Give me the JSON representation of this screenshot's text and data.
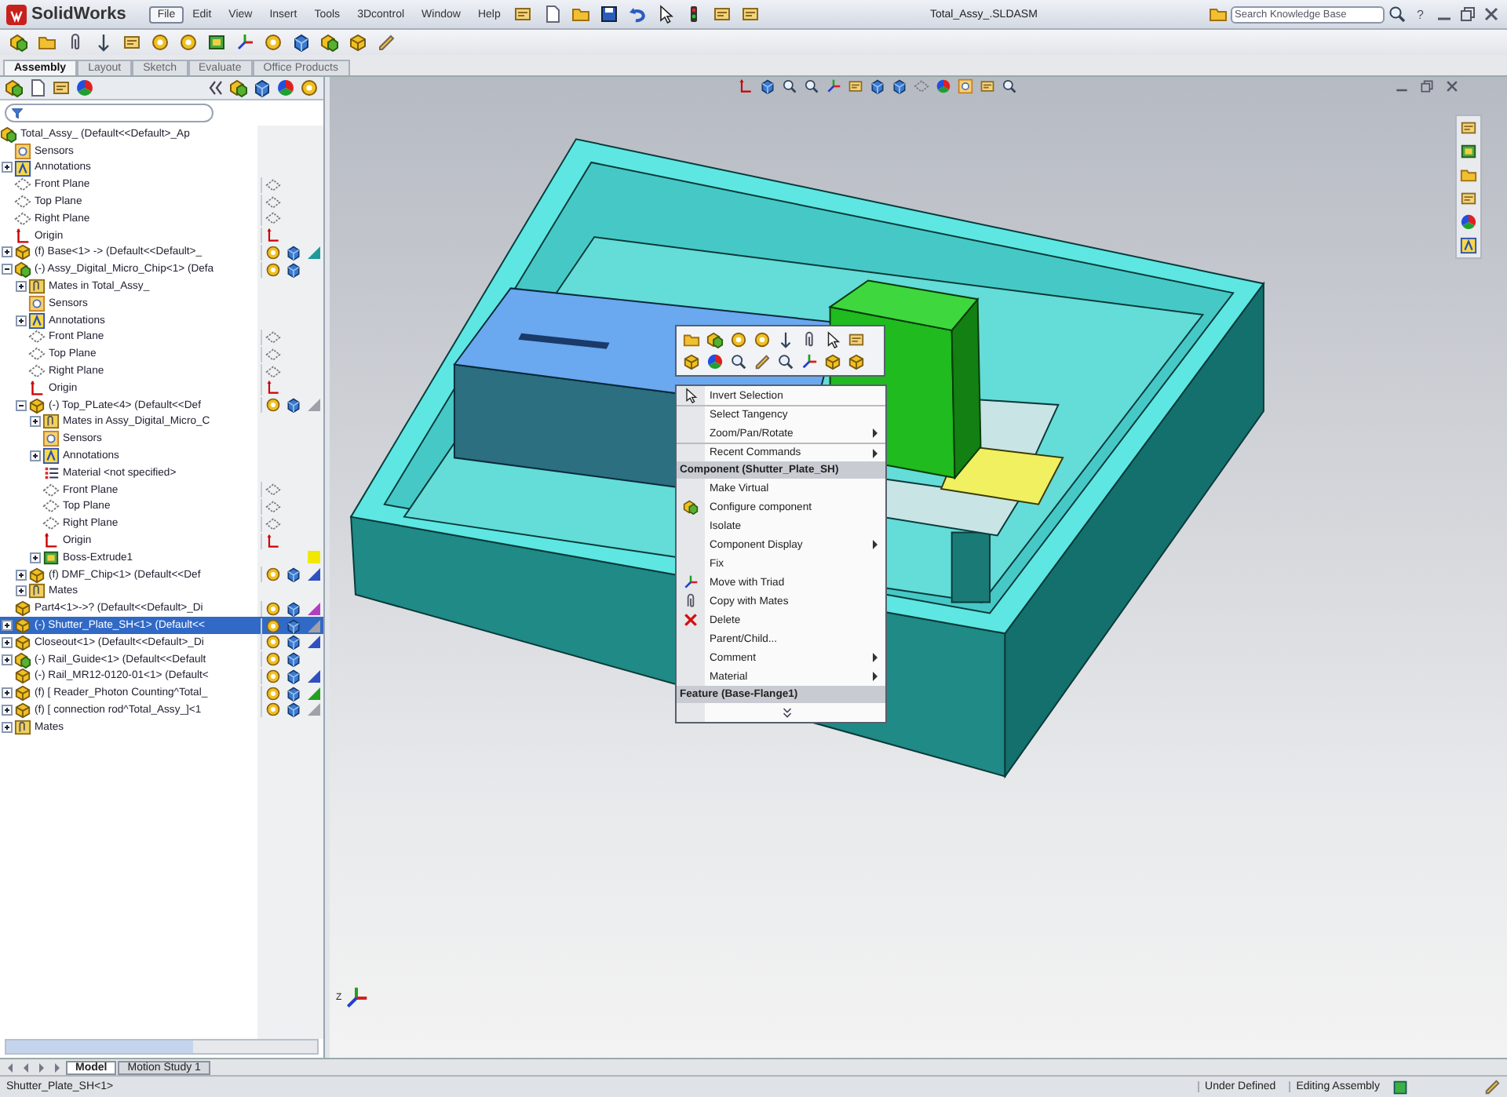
{
  "app": {
    "logo": "SolidWorks",
    "menu": [
      {
        "label": "File",
        "selected": true
      },
      {
        "label": "Edit",
        "selected": false
      },
      {
        "label": "View",
        "selected": false
      },
      {
        "label": "Insert",
        "selected": false
      },
      {
        "label": "Tools",
        "selected": false
      },
      {
        "label": "3Dcontrol",
        "selected": false
      },
      {
        "label": "Window",
        "selected": false
      },
      {
        "label": "Help",
        "selected": false
      }
    ],
    "title": "Total_Assy_.SLDASM",
    "search": {
      "placeholder": "Search Knowledge Base"
    },
    "help": "?"
  },
  "command_tabs": [
    {
      "label": "Assembly",
      "selected": true
    },
    {
      "label": "Layout",
      "selected": false
    },
    {
      "label": "Sketch",
      "selected": false
    },
    {
      "label": "Evaluate",
      "selected": false
    },
    {
      "label": "Office Products",
      "selected": false
    }
  ],
  "feature_tree": {
    "items": [
      {
        "label": "Total_Assy_ (Default<<Default>_Ap",
        "kind": "assembly",
        "selected": false,
        "children": [
          {
            "label": "Sensors",
            "kind": "sensors",
            "selected": false
          },
          {
            "label": "Annotations",
            "kind": "annotations",
            "expanded": false,
            "selected": false
          },
          {
            "label": "Front Plane",
            "kind": "plane",
            "selected": false
          },
          {
            "label": "Top Plane",
            "kind": "plane",
            "selected": false
          },
          {
            "label": "Right Plane",
            "kind": "plane",
            "selected": false
          },
          {
            "label": "Origin",
            "kind": "origin",
            "selected": false
          },
          {
            "label": "(f) Base<1> -> (Default<<Default>_",
            "kind": "part",
            "expanded": false,
            "selected": false,
            "color": "#1e9a9a"
          },
          {
            "label": "(-) Assy_Digital_Micro_Chip<1> (Defa",
            "kind": "assembly",
            "expanded": true,
            "selected": false,
            "children": [
              {
                "label": "Mates in Total_Assy_",
                "kind": "mates",
                "expanded": false,
                "selected": false
              },
              {
                "label": "Sensors",
                "kind": "sensors",
                "selected": false
              },
              {
                "label": "Annotations",
                "kind": "annotations",
                "expanded": false,
                "selected": false
              },
              {
                "label": "Front Plane",
                "kind": "plane",
                "selected": false
              },
              {
                "label": "Top Plane",
                "kind": "plane",
                "selected": false
              },
              {
                "label": "Right Plane",
                "kind": "plane",
                "selected": false
              },
              {
                "label": "Origin",
                "kind": "origin",
                "selected": false
              },
              {
                "label": "(-) Top_PLate<4> (Default<<Def",
                "kind": "part",
                "expanded": true,
                "selected": false,
                "color": "#a0a0a8",
                "children": [
                  {
                    "label": "Mates in Assy_Digital_Micro_C",
                    "kind": "mates",
                    "expanded": false,
                    "selected": false
                  },
                  {
                    "label": "Sensors",
                    "kind": "sensors",
                    "selected": false
                  },
                  {
                    "label": "Annotations",
                    "kind": "annotations",
                    "expanded": false,
                    "selected": false
                  },
                  {
                    "label": "Material <not specified>",
                    "kind": "material",
                    "selected": false
                  },
                  {
                    "label": "Front Plane",
                    "kind": "plane",
                    "selected": false
                  },
                  {
                    "label": "Top Plane",
                    "kind": "plane",
                    "selected": false
                  },
                  {
                    "label": "Right Plane",
                    "kind": "plane",
                    "selected": false
                  },
                  {
                    "label": "Origin",
                    "kind": "origin",
                    "selected": false
                  },
                  {
                    "label": "Boss-Extrude1",
                    "kind": "feature",
                    "expanded": false,
                    "selected": false,
                    "color": "#f0e800"
                  }
                ]
              },
              {
                "label": "(f) DMF_Chip<1> (Default<<Def",
                "kind": "part",
                "expanded": false,
                "selected": false,
                "color": "#3050c0"
              },
              {
                "label": "Mates",
                "kind": "mates",
                "expanded": false,
                "selected": false
              }
            ]
          },
          {
            "label": "Part4<1>->? (Default<<Default>_Di",
            "kind": "part",
            "selected": false,
            "color": "#b040c0"
          },
          {
            "label": "(-) Shutter_Plate_SH<1> (Default<<",
            "kind": "part",
            "expanded": false,
            "selected": true,
            "color": "#a0a0a8"
          },
          {
            "label": "Closeout<1> (Default<<Default>_Di",
            "kind": "part",
            "expanded": false,
            "selected": false,
            "color": "#3050c0"
          },
          {
            "label": "(-) Rail_Guide<1> (Default<<Default",
            "kind": "assembly",
            "expanded": false,
            "selected": false
          },
          {
            "label": "(-) Rail_MR12-0120-01<1> (Default<",
            "kind": "part",
            "selected": false,
            "color": "#3050c0"
          },
          {
            "label": "(f) [ Reader_Photon Counting^Total_",
            "kind": "part",
            "expanded": false,
            "selected": false,
            "color": "#20a020"
          },
          {
            "label": "(f) [ connection rod^Total_Assy_]<1",
            "kind": "part",
            "expanded": false,
            "selected": false,
            "color": "#a0a0a8"
          },
          {
            "label": "Mates",
            "kind": "mates",
            "expanded": false,
            "selected": false
          }
        ]
      }
    ]
  },
  "bottom_tabs": [
    {
      "label": "Model",
      "selected": true
    },
    {
      "label": "Motion Study 1",
      "selected": false
    }
  ],
  "context_menu": {
    "items": [
      {
        "label": "Invert Selection",
        "kind": "item",
        "submenu": false,
        "divider_before": false
      },
      {
        "label": "Select Tangency",
        "kind": "item",
        "submenu": false,
        "divider_before": true
      },
      {
        "label": "Zoom/Pan/Rotate",
        "kind": "item",
        "submenu": true,
        "divider_before": false
      },
      {
        "label": "Recent Commands",
        "kind": "item",
        "submenu": true,
        "divider_before": true
      },
      {
        "label": "Component (Shutter_Plate_SH)",
        "kind": "header"
      },
      {
        "label": "Make Virtual",
        "kind": "item",
        "submenu": false,
        "divider_before": false
      },
      {
        "label": "Configure component",
        "kind": "item",
        "submenu": false,
        "divider_before": false
      },
      {
        "label": "Isolate",
        "kind": "item",
        "submenu": false,
        "divider_before": false
      },
      {
        "label": "Component Display",
        "kind": "item",
        "submenu": true,
        "divider_before": false
      },
      {
        "label": "Fix",
        "kind": "item",
        "submenu": false,
        "divider_before": false
      },
      {
        "label": "Move with Triad",
        "kind": "item",
        "submenu": false,
        "divider_before": false
      },
      {
        "label": "Copy with Mates",
        "kind": "item",
        "submenu": false,
        "divider_before": false
      },
      {
        "label": "Delete",
        "kind": "item",
        "submenu": false,
        "divider_before": false
      },
      {
        "label": "Parent/Child...",
        "kind": "item",
        "submenu": false,
        "divider_before": false
      },
      {
        "label": "Comment",
        "kind": "item",
        "submenu": true,
        "divider_before": false
      },
      {
        "label": "Material",
        "kind": "item",
        "submenu": true,
        "divider_before": false
      },
      {
        "label": "Feature (Base-Flange1)",
        "kind": "header"
      },
      {
        "kind": "more"
      }
    ]
  },
  "triad": {
    "label": "Z"
  },
  "status_bar": {
    "selection": "Shutter_Plate_SH<1>",
    "state": "Under Defined",
    "mode": "Editing Assembly"
  }
}
